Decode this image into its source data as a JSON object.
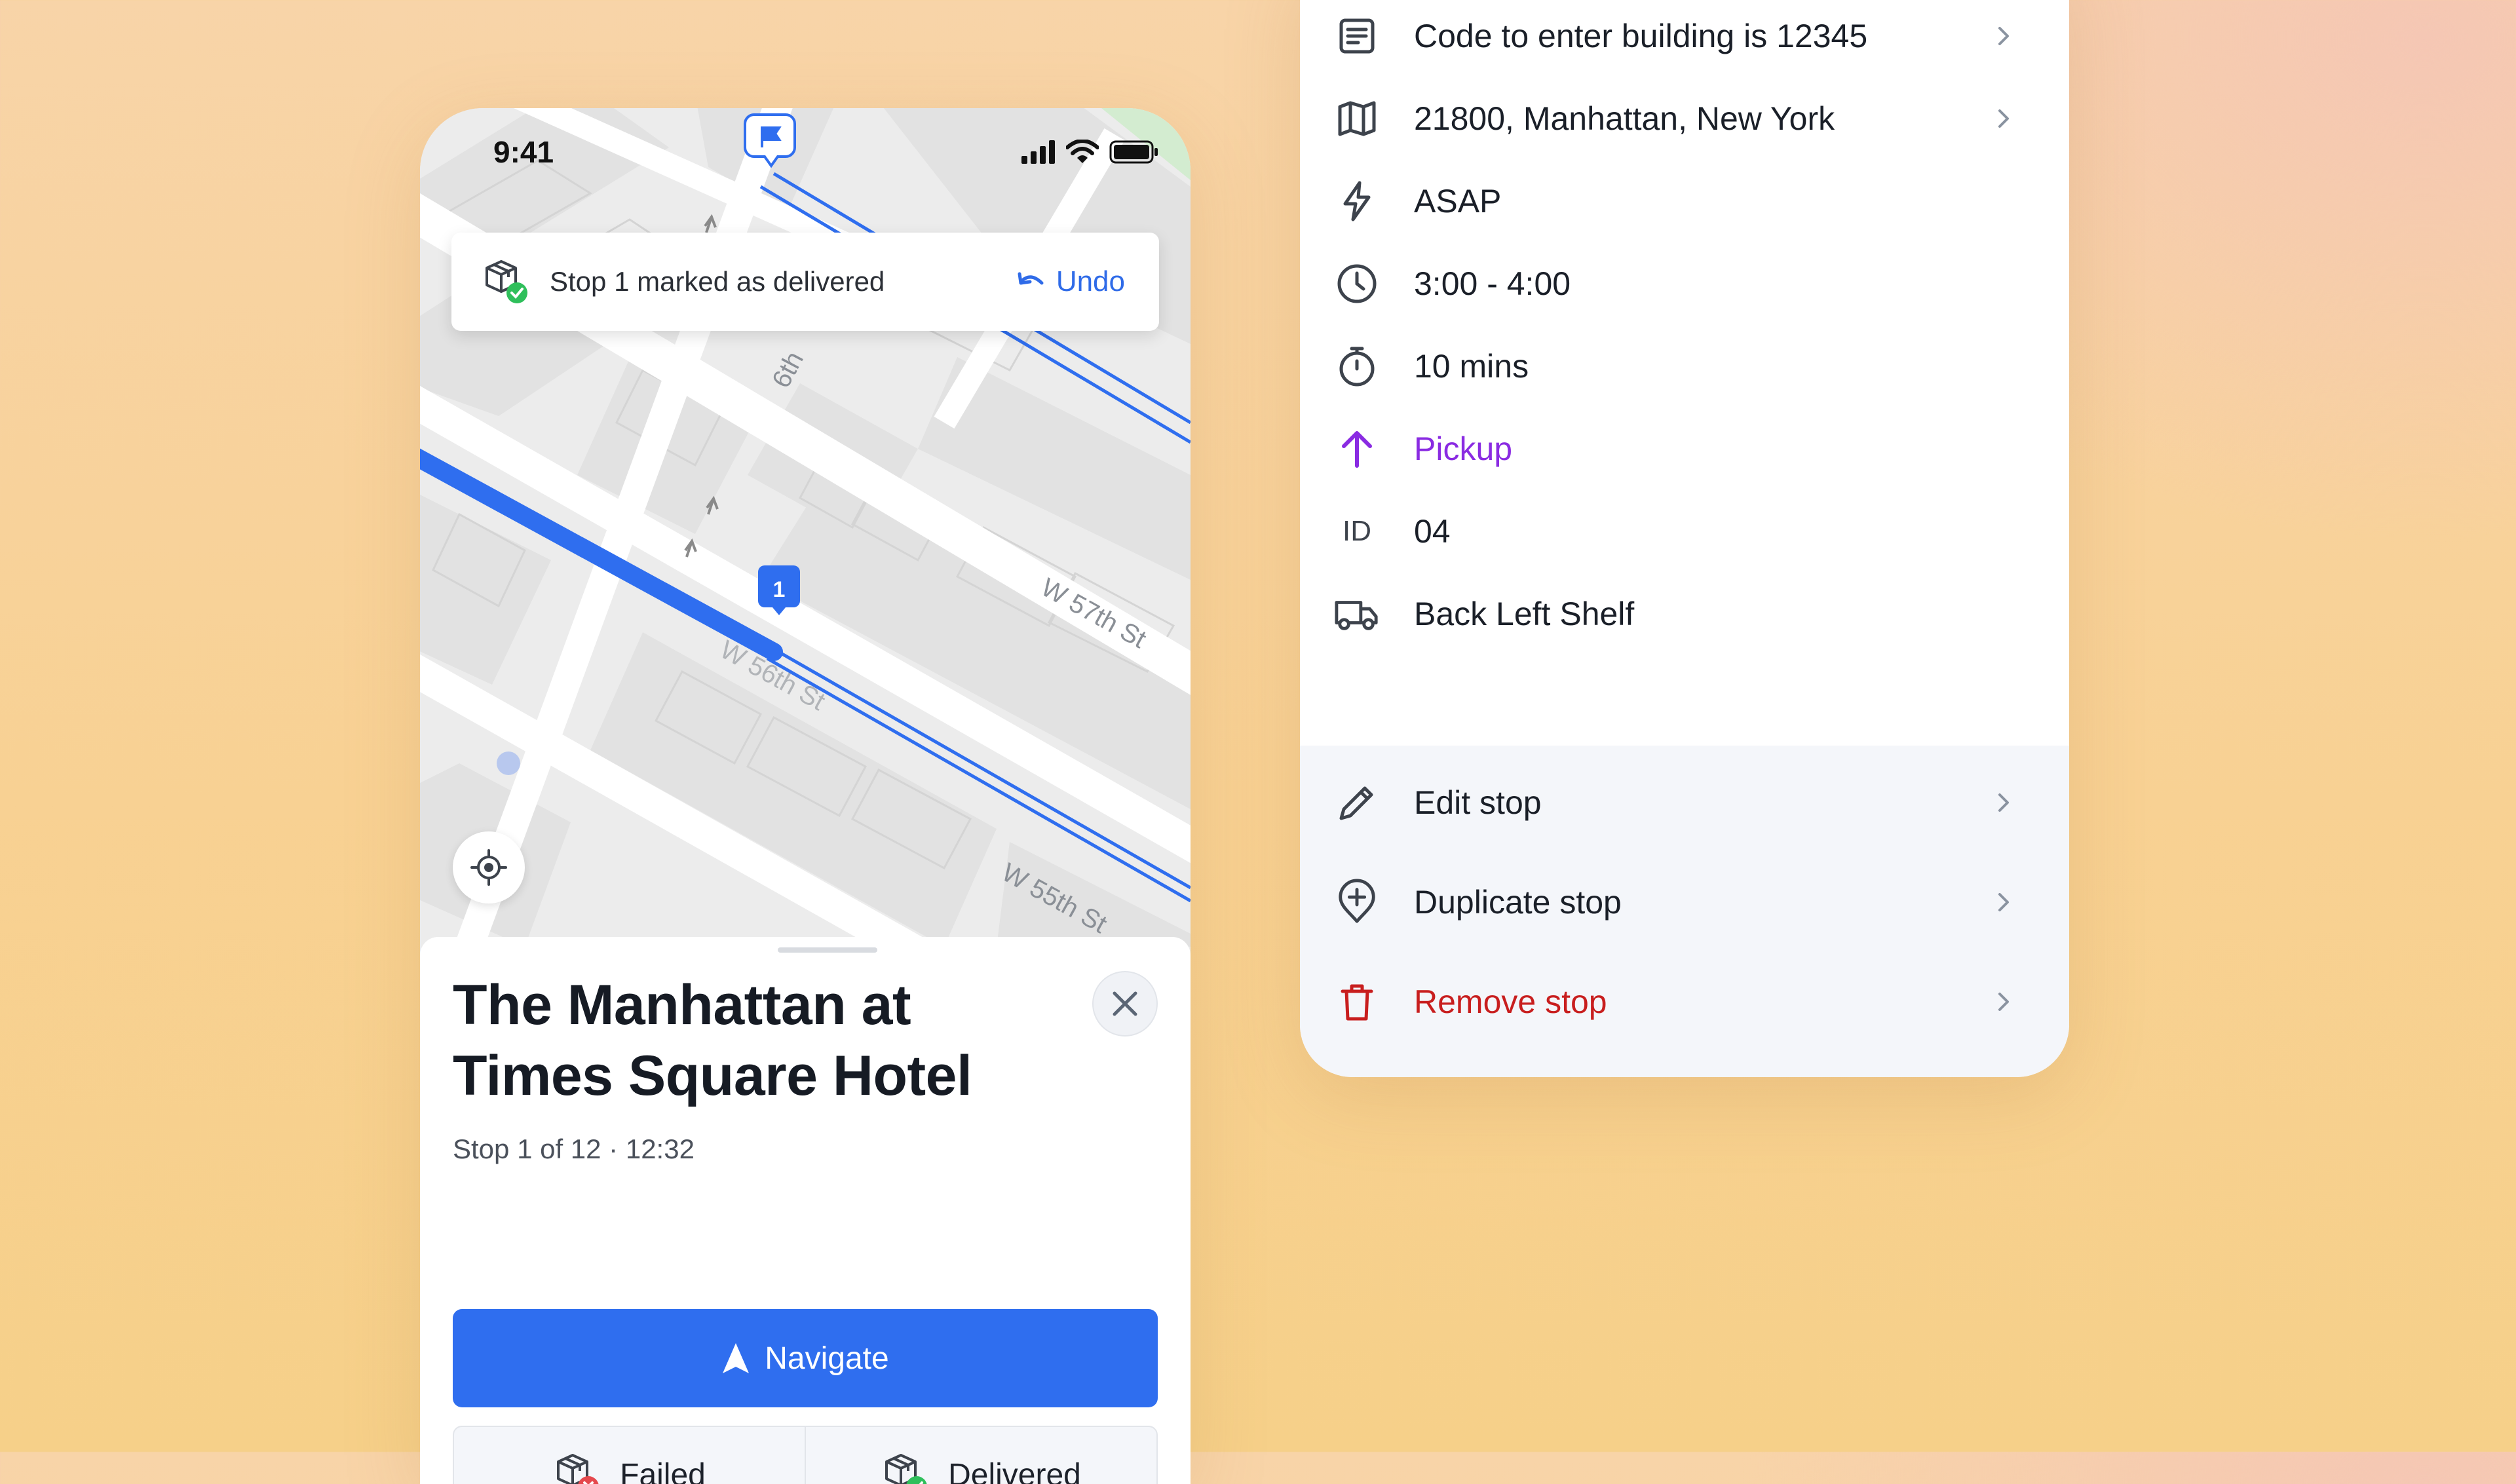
{
  "status_bar": {
    "time": "9:41"
  },
  "map": {
    "streets": [
      "6th",
      "W 57th St",
      "W 55th St",
      "W 56th St"
    ],
    "stop_marker": "1"
  },
  "toast": {
    "message": "Stop 1 marked as delivered",
    "undo_label": "Undo"
  },
  "stop": {
    "title": "The Manhattan at Times Square Hotel",
    "subtitle": "Stop 1 of 12 · 12:32",
    "navigate_label": "Navigate",
    "failed_label": "Failed",
    "delivered_label": "Delivered"
  },
  "details": [
    {
      "icon": "note-icon",
      "text": "Code to enter building is 12345",
      "chevron": true
    },
    {
      "icon": "map-icon",
      "text": "21800, Manhattan, New York",
      "chevron": true
    },
    {
      "icon": "lightning-icon",
      "text": "ASAP",
      "chevron": false
    },
    {
      "icon": "clock-icon",
      "text": "3:00 - 4:00",
      "chevron": false
    },
    {
      "icon": "stopwatch-icon",
      "text": "10 mins",
      "chevron": false
    },
    {
      "icon": "arrow-up-icon",
      "text": "Pickup",
      "chevron": false,
      "color": "#8a2be2"
    },
    {
      "icon": "id-label",
      "icon_text": "ID",
      "text": "04",
      "chevron": false
    },
    {
      "icon": "truck-icon",
      "text": "Back Left Shelf",
      "chevron": false
    }
  ],
  "actions": {
    "edit": "Edit stop",
    "duplicate": "Duplicate stop",
    "remove": "Remove stop"
  },
  "colors": {
    "accent": "#2f6eef",
    "pickup": "#8a2be2",
    "danger": "#c81e1e",
    "success": "#2fbf5b"
  }
}
